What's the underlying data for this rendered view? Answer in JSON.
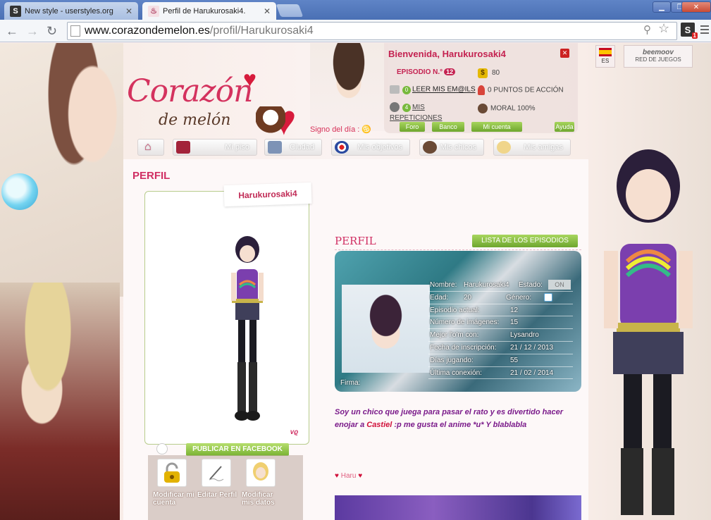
{
  "browser": {
    "tabs": [
      {
        "title": "New style - userstyles.org",
        "favicon": "S"
      },
      {
        "title": "Perfil de Harukurosaki4.",
        "favicon": "cupcake"
      }
    ],
    "url_host": "www.corazondemelon.es",
    "url_path": "/profil/Harukurosaki4",
    "extension_badge": "1"
  },
  "header": {
    "logo_main": "Corazón",
    "logo_sub": "de melón",
    "signo_label": "Signo del día :",
    "lang_label": "ES",
    "partner_name": "beemoov",
    "partner_sub": "RED DE JUEGOS"
  },
  "account": {
    "welcome": "Bienvenida, Harukurosaki4",
    "episode_label": "EPISODIO N.°",
    "episode_num": "12",
    "coins": "80",
    "mail_count": "0",
    "mail_label": "LEER MIS EM@ILS",
    "action_points": "0 PUNTOS DE ACCIÓN",
    "reps_count": "4",
    "reps_label": "MIS REPETICIONES",
    "moral": "MORAL 100%",
    "btn_foro": "Foro",
    "btn_banco": "Banco",
    "btn_cuenta": "Mi cuenta",
    "btn_ayuda": "Ayuda"
  },
  "nav": {
    "items": [
      "Mi piso",
      "Ciudad",
      "Mis objetivos",
      "Mis chicos",
      "Mis amigas"
    ]
  },
  "profile": {
    "page_title": "PERFIL",
    "username": "Harukurosaki4",
    "section_title": "PERFIL",
    "episodes_button": "LISTA DE LOS EPISODIOS",
    "facebook_button": "PUBLICAR EN FACEBOOK",
    "actions": [
      "Modificar mi cuenta",
      "Editar Perfil",
      "Modificar mis datos"
    ],
    "fields": [
      {
        "k": "Nombre:",
        "v": "Harukurosaki4",
        "k2": "Estado:",
        "badge": "ON"
      },
      {
        "k": "Edad:",
        "v": "20",
        "k2": "Género:"
      },
      {
        "k": "Episodio actual:",
        "v": "12"
      },
      {
        "k": "Número de imágenes:",
        "v": "15"
      },
      {
        "k": "Mejor l'o'm con:",
        "v": "Lysandro"
      },
      {
        "k": "Fecha de inscripción:",
        "v": "21 / 12 / 2013"
      },
      {
        "k": "Días jugando:",
        "v": "55"
      },
      {
        "k": "Última conexión:",
        "v": "21 / 02 / 2014"
      }
    ],
    "firma_label": "Firma:",
    "bio_part1": "Soy un chico que juega para pasar el rato y es divertido hacer enojar a",
    "bio_name": "Castiel",
    "bio_part2": ":p me gusta el anime *u* Y blablabla",
    "signature_text": "Haru"
  }
}
